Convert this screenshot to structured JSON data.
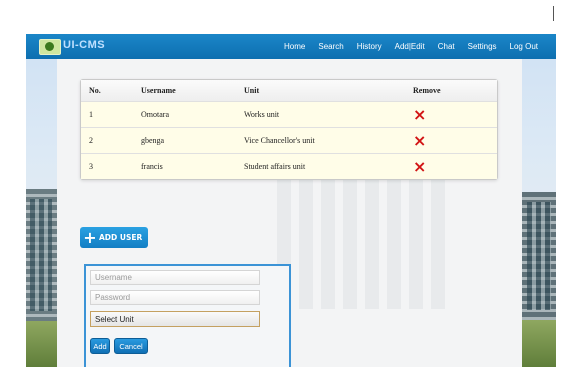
{
  "app": {
    "title": "UI-CMS"
  },
  "nav": {
    "items": [
      {
        "label": "Home"
      },
      {
        "label": "Search"
      },
      {
        "label": "History"
      },
      {
        "label": "Add|Edit"
      },
      {
        "label": "Chat"
      },
      {
        "label": "Settings"
      },
      {
        "label": "Log Out"
      }
    ]
  },
  "table": {
    "headers": {
      "no": "No.",
      "username": "Username",
      "unit": "Unit",
      "remove": "Remove"
    },
    "rows": [
      {
        "no": "1",
        "username": "Omotara",
        "unit": "Works unit"
      },
      {
        "no": "2",
        "username": "gbenga",
        "unit": "Vice Chancellor's unit"
      },
      {
        "no": "3",
        "username": "francis",
        "unit": "Student affairs unit"
      }
    ],
    "remove_icon": "×"
  },
  "add_user": {
    "label": "ADD USER",
    "icon": "+"
  },
  "form": {
    "username_placeholder": "Username",
    "password_placeholder": "Password",
    "unit_selected": "Select Unit",
    "add_label": "Add",
    "cancel_label": "Cancel"
  },
  "colors": {
    "navbar": "#0d6fb0",
    "accent_button": "#1b8fd6",
    "remove_icon": "#d21414",
    "row_highlight": "#fffde8"
  }
}
